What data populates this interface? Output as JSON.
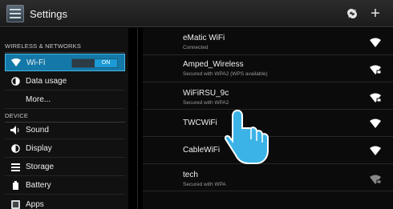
{
  "header": {
    "title": "Settings",
    "icons": [
      "settings-app-icon",
      "sync-icon",
      "add-icon"
    ],
    "add_glyph": "+"
  },
  "sidebar": {
    "section_wireless": "WIRELESS & NETWORKS",
    "wifi_label": "Wi-Fi",
    "wifi_toggle": "ON",
    "data_usage": "Data usage",
    "more": "More...",
    "section_device": "DEVICE",
    "sound": "Sound",
    "display": "Display",
    "storage": "Storage",
    "battery": "Battery",
    "apps": "Apps"
  },
  "networks": [
    {
      "name": "eMatic WiFi",
      "status": "Connected",
      "locked": false
    },
    {
      "name": "Amped_Wireless",
      "status": "Secured with WPA2 (WPS available)",
      "locked": true
    },
    {
      "name": "WiFiRSU_9c",
      "status": "Secured with WPA2",
      "locked": true
    },
    {
      "name": "TWCWiFi",
      "status": "",
      "locked": false
    },
    {
      "name": "CableWiFi",
      "status": "",
      "locked": false
    },
    {
      "name": "tech",
      "status": "Secured with WPA",
      "locked": true
    }
  ],
  "colors": {
    "accent": "#1479a8",
    "toggle_on": "#1b9ad6",
    "hand": "#3bb3e6"
  }
}
